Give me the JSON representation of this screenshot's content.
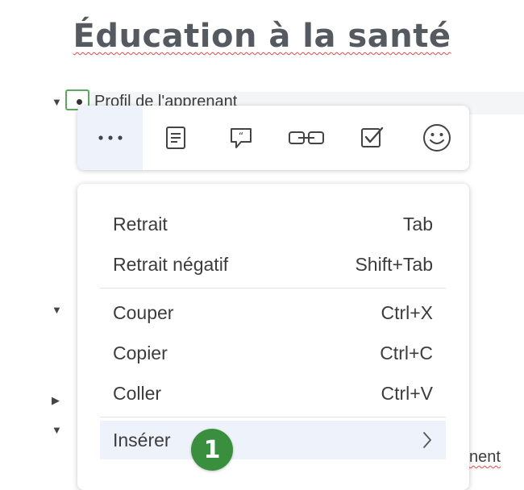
{
  "page": {
    "title": "Éducation à la santé"
  },
  "outline": {
    "current_node": "Profil de l'apprenant",
    "partial_node": "nent"
  },
  "toolbar": {
    "buttons": [
      {
        "name": "more",
        "icon": "more-horizontal-icon"
      },
      {
        "name": "note",
        "icon": "note-icon"
      },
      {
        "name": "comment",
        "icon": "quote-comment-icon"
      },
      {
        "name": "link",
        "icon": "link-icon"
      },
      {
        "name": "task",
        "icon": "checkbox-icon"
      },
      {
        "name": "emoji",
        "icon": "smiley-icon"
      }
    ]
  },
  "menu": {
    "items": [
      {
        "label": "Retrait",
        "shortcut": "Tab"
      },
      {
        "label": "Retrait négatif",
        "shortcut": "Shift+Tab"
      },
      {
        "label": "Couper",
        "shortcut": "Ctrl+X"
      },
      {
        "label": "Copier",
        "shortcut": "Ctrl+C"
      },
      {
        "label": "Coller",
        "shortcut": "Ctrl+V"
      },
      {
        "label": "Insérer",
        "submenu_icon": "chevron-right-icon"
      }
    ]
  },
  "annotation": {
    "step": "1",
    "color": "#3a8f3e"
  }
}
